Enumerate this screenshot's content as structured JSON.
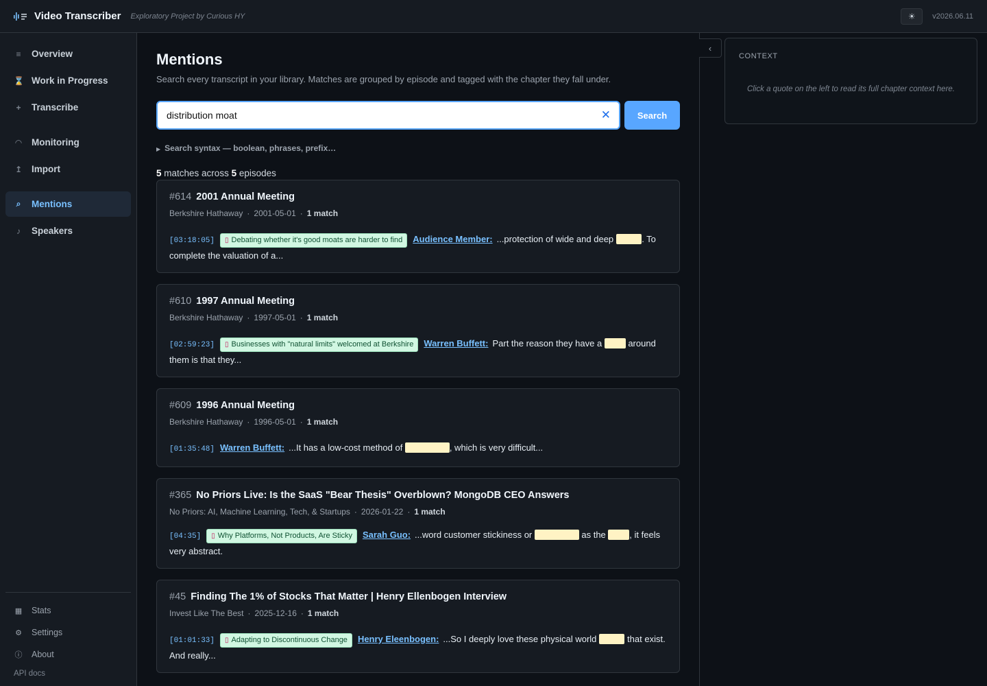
{
  "app": {
    "title": "Video Transcriber",
    "subtitle": "Exploratory Project by Curious HY",
    "version": "v2026.06.11",
    "theme_icon": "sun-icon"
  },
  "sidebar": {
    "items": [
      {
        "label": "Overview",
        "icon": "list-icon"
      },
      {
        "label": "Work in Progress",
        "icon": "hourglass-icon"
      },
      {
        "label": "Transcribe",
        "icon": "plus-icon"
      },
      {
        "label": "Monitoring",
        "icon": "signal-icon"
      },
      {
        "label": "Import",
        "icon": "import-icon"
      },
      {
        "label": "Mentions",
        "icon": "search-icon",
        "active": true
      },
      {
        "label": "Speakers",
        "icon": "music-note-icon"
      }
    ],
    "bottom": [
      {
        "label": "Stats",
        "icon": "stats-icon"
      },
      {
        "label": "Settings",
        "icon": "gear-icon"
      },
      {
        "label": "About",
        "icon": "info-icon"
      }
    ],
    "api_docs": "API docs"
  },
  "main": {
    "title": "Mentions",
    "description": "Search every transcript in your library. Matches are grouped by episode and tagged with the chapter they fall under.",
    "search": {
      "value": "distribution moat",
      "button": "Search"
    },
    "syntax_toggle": "Search syntax — boolean, phrases, prefix…",
    "summary": {
      "matches": "5",
      "matches_label": "matches across",
      "episodes": "5",
      "episodes_label": "episodes"
    },
    "results": [
      {
        "num": "#614",
        "title": "2001 Annual Meeting",
        "channel": "Berkshire Hathaway",
        "date": "2001-05-01",
        "match_count": "1 match",
        "timestamp": "[03:18:05]",
        "chapter": "Debating whether it's good moats are harder to find",
        "speaker": "Audience Member:",
        "pre": "...protection of wide and deep ",
        "hl1": "moats",
        "mid": ". To complete the valuation of a...",
        "hl2": "",
        "post": ""
      },
      {
        "num": "#610",
        "title": "1997 Annual Meeting",
        "channel": "Berkshire Hathaway",
        "date": "1997-05-01",
        "match_count": "1 match",
        "timestamp": "[02:59:23]",
        "chapter": "Businesses with \"natural limits\" welcomed at Berkshire",
        "speaker": "Warren Buffett:",
        "pre": "Part the reason they have a ",
        "hl1": "moat",
        "mid": " around them is that they...",
        "hl2": "",
        "post": ""
      },
      {
        "num": "#609",
        "title": "1996 Annual Meeting",
        "channel": "Berkshire Hathaway",
        "date": "1996-05-01",
        "match_count": "1 match",
        "timestamp": "[01:35:48]",
        "chapter": "",
        "speaker": "Warren Buffett:",
        "pre": "...It has a low-cost method of ",
        "hl1": "distribution",
        "mid": ", which is very difficult...",
        "hl2": "",
        "post": ""
      },
      {
        "num": "#365",
        "title": "No Priors Live: Is the SaaS \"Bear Thesis\" Overblown? MongoDB CEO Answers",
        "channel": "No Priors: AI, Machine Learning, Tech, & Startups",
        "date": "2026-01-22",
        "match_count": "1 match",
        "timestamp": "[04:35]",
        "chapter": "Why Platforms, Not Products, Are Sticky",
        "speaker": "Sarah Guo:",
        "pre": "...word customer stickiness or ",
        "hl1": "distribution",
        "mid": " as the ",
        "hl2": "moat",
        "post": ", it feels very abstract."
      },
      {
        "num": "#45",
        "title": "Finding The 1% of Stocks That Matter | Henry Ellenbogen Interview",
        "channel": "Invest Like The Best",
        "date": "2025-12-16",
        "match_count": "1 match",
        "timestamp": "[01:01:33]",
        "chapter": "Adapting to Discontinuous Change",
        "speaker": "Henry Eleenbogen:",
        "pre": "...So I deeply love these physical world ",
        "hl1": "moats",
        "mid": " that exist. And really...",
        "hl2": "",
        "post": ""
      }
    ]
  },
  "context": {
    "title": "CONTEXT",
    "hint": "Click a quote on the left to read its full chapter context here."
  }
}
